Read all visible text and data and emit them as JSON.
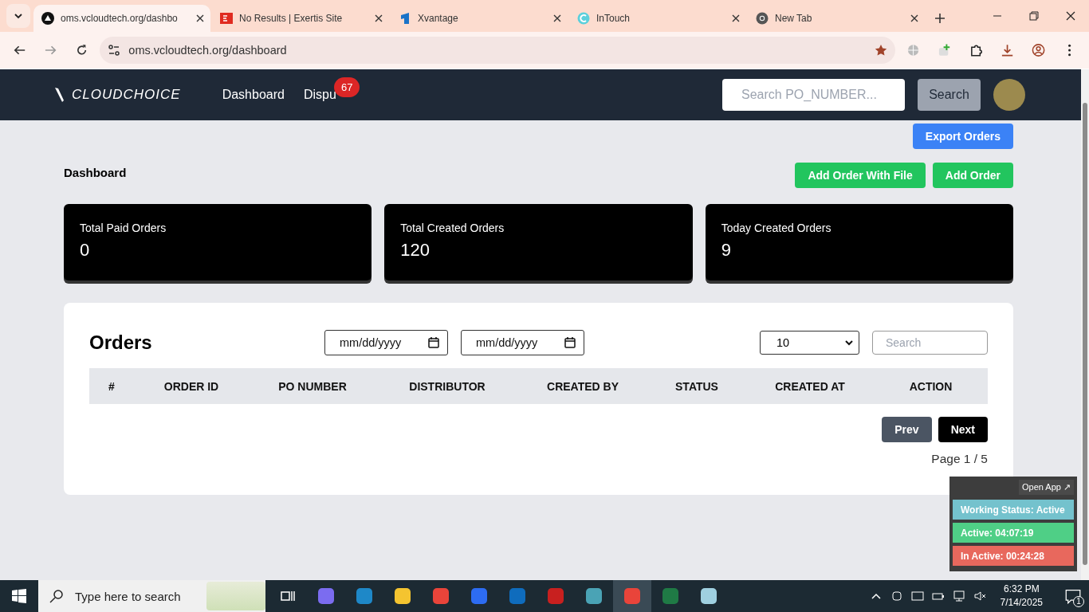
{
  "browser": {
    "tabs": [
      {
        "title": "oms.vcloudtech.org/dashbo",
        "selected": true,
        "kind": "triangle"
      },
      {
        "title": "No Results | Exertis Site",
        "selected": false,
        "kind": "ex"
      },
      {
        "title": "Xvantage",
        "selected": false,
        "kind": "x"
      },
      {
        "title": "InTouch",
        "selected": false,
        "kind": "c"
      },
      {
        "title": "New Tab",
        "selected": false,
        "kind": "chrome"
      }
    ],
    "address": "oms.vcloudtech.org/dashboard"
  },
  "navbar": {
    "logo": "CLOUDCHOICE",
    "links": [
      {
        "label": "Dashboard"
      },
      {
        "label": "Dispu",
        "badge": "67"
      }
    ],
    "search_placeholder": "Search PO_NUMBER...",
    "search_button": "Search"
  },
  "export_button": "Export Orders",
  "page_title": "Dashboard",
  "actions": [
    "Add Order With File",
    "Add Order"
  ],
  "stats": [
    {
      "label": "Total Paid Orders",
      "value": "0"
    },
    {
      "label": "Total Created Orders",
      "value": "120"
    },
    {
      "label": "Today Created Orders",
      "value": "9"
    }
  ],
  "orders": {
    "title": "Orders",
    "date_from": "mm/dd/yyyy",
    "date_to": "mm/dd/yyyy",
    "page_size": "10",
    "search_placeholder": "Search",
    "columns": [
      "#",
      "ORDER ID",
      "PO NUMBER",
      "DISTRIBUTOR",
      "CREATED BY",
      "STATUS",
      "CREATED AT",
      "ACTION"
    ],
    "prev": "Prev",
    "next": "Next",
    "page": "Page 1 / 5"
  },
  "widget": {
    "open_app": "Open App ↗",
    "statuses": [
      {
        "text": "Working Status: Active",
        "color": "#74c2cd"
      },
      {
        "text": "Active: 04:07:19",
        "color": "#4fcf86"
      },
      {
        "text": "In Active: 00:24:28",
        "color": "#e8685d"
      }
    ]
  },
  "taskbar": {
    "search_placeholder": "Type here to search",
    "time": "6:32 PM",
    "date": "7/14/2025",
    "notifications": "1"
  }
}
